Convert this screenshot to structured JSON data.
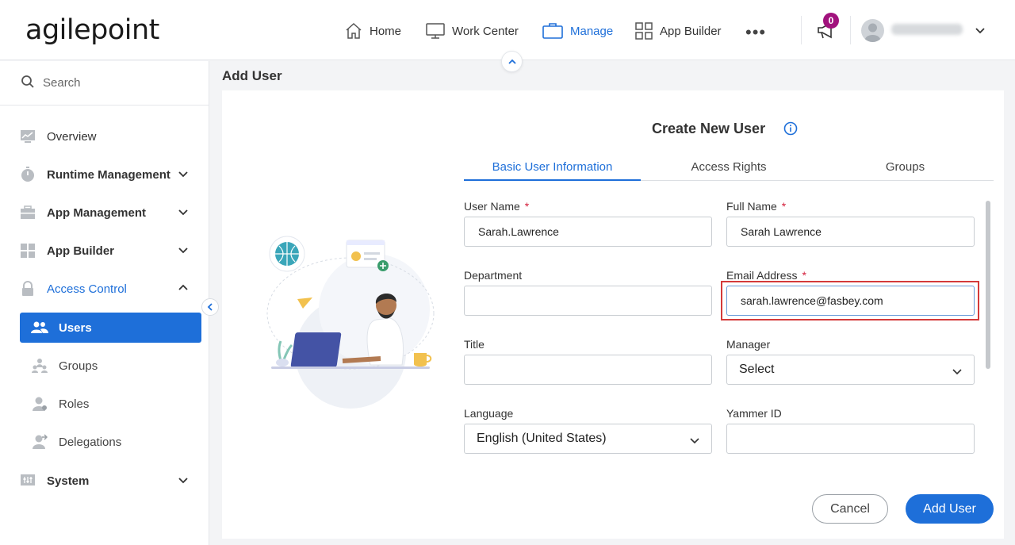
{
  "header": {
    "logo": "agilepoint",
    "nav": [
      {
        "label": "Home",
        "icon": "home-icon"
      },
      {
        "label": "Work Center",
        "icon": "monitor-icon"
      },
      {
        "label": "Manage",
        "icon": "briefcase-icon",
        "active": true
      },
      {
        "label": "App Builder",
        "icon": "grid-icon"
      }
    ],
    "more": "•••",
    "notification_count": "0"
  },
  "sidebar": {
    "search_placeholder": "Search",
    "items": [
      {
        "label": "Overview",
        "icon": "chart-icon"
      },
      {
        "label": "Runtime Management",
        "icon": "timer-icon"
      },
      {
        "label": "App Management",
        "icon": "toolbox-icon"
      },
      {
        "label": "App Builder",
        "icon": "grid-icon"
      },
      {
        "label": "Access Control",
        "icon": "lock-icon",
        "expanded": true
      },
      {
        "label": "System",
        "icon": "sliders-icon"
      }
    ],
    "subitems": [
      {
        "label": "Users",
        "icon": "users-icon",
        "active": true
      },
      {
        "label": "Groups",
        "icon": "groups-icon"
      },
      {
        "label": "Roles",
        "icon": "roles-icon"
      },
      {
        "label": "Delegations",
        "icon": "delegation-icon"
      }
    ]
  },
  "page": {
    "title": "Add User",
    "card_title": "Create New User",
    "tabs": [
      "Basic User Information",
      "Access Rights",
      "Groups"
    ]
  },
  "form": {
    "user_name": {
      "label": "User Name",
      "value": "Sarah.Lawrence",
      "required": "*"
    },
    "full_name": {
      "label": "Full Name",
      "value": "Sarah Lawrence",
      "required": "*"
    },
    "department": {
      "label": "Department",
      "value": ""
    },
    "email": {
      "label": "Email Address",
      "value": "sarah.lawrence@fasbey.com",
      "required": "*"
    },
    "title": {
      "label": "Title",
      "value": ""
    },
    "manager": {
      "label": "Manager",
      "value": "Select"
    },
    "language": {
      "label": "Language",
      "value": "English (United States)"
    },
    "yammer": {
      "label": "Yammer ID",
      "value": ""
    }
  },
  "buttons": {
    "cancel": "Cancel",
    "add": "Add User"
  },
  "colors": {
    "accent": "#1e6fd9",
    "badge": "#a1127d",
    "required": "#d4213d",
    "highlight": "#d43a3a"
  }
}
